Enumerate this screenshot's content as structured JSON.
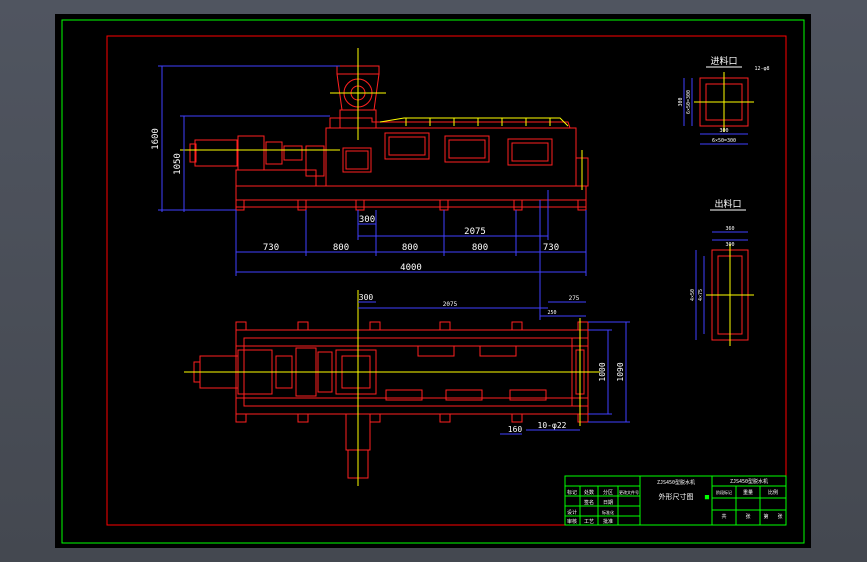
{
  "drawing": {
    "colors": {
      "background": "#000000",
      "outer_border": "#00ff00",
      "inner_border": "#ff0000",
      "dimension": "#4040ff",
      "outline": "#ff2020",
      "centerline": "#ffff00",
      "text": "#ffffff"
    },
    "side_view": {
      "height_labels": [
        "1600",
        "1050"
      ],
      "dim_300": "300",
      "dim_2075": "2075",
      "segments": [
        "730",
        "800",
        "800",
        "800",
        "730"
      ],
      "total": "4000"
    },
    "plan_view": {
      "dim_300": "300",
      "dim_2075": "2075",
      "dim_275": "275",
      "dim_250": "250",
      "width_labels": [
        "1000",
        "1090"
      ],
      "dim_160": "160",
      "holes": "10-φ22"
    },
    "inlet_detail": {
      "title": "进料口",
      "note": "12-φ8",
      "dims": [
        "300",
        "6×50=300",
        "300",
        "6×50=300"
      ]
    },
    "outlet_detail": {
      "title": "出料口",
      "dims": [
        "360",
        "300",
        "4×50",
        "4×75"
      ]
    },
    "title_block": {
      "drawing_name": "外形尺寸图",
      "product": "ZJS450型脱水机",
      "product_short": "ZJS450",
      "check_box": "■",
      "labels": [
        "标记",
        "处数",
        "分区",
        "更改文件号",
        "签名",
        "日期",
        "设计",
        "标准化",
        "阶段标记",
        "重量",
        "比例",
        "审核",
        "工艺",
        "批准",
        "共",
        "张",
        "第",
        "张"
      ]
    }
  }
}
